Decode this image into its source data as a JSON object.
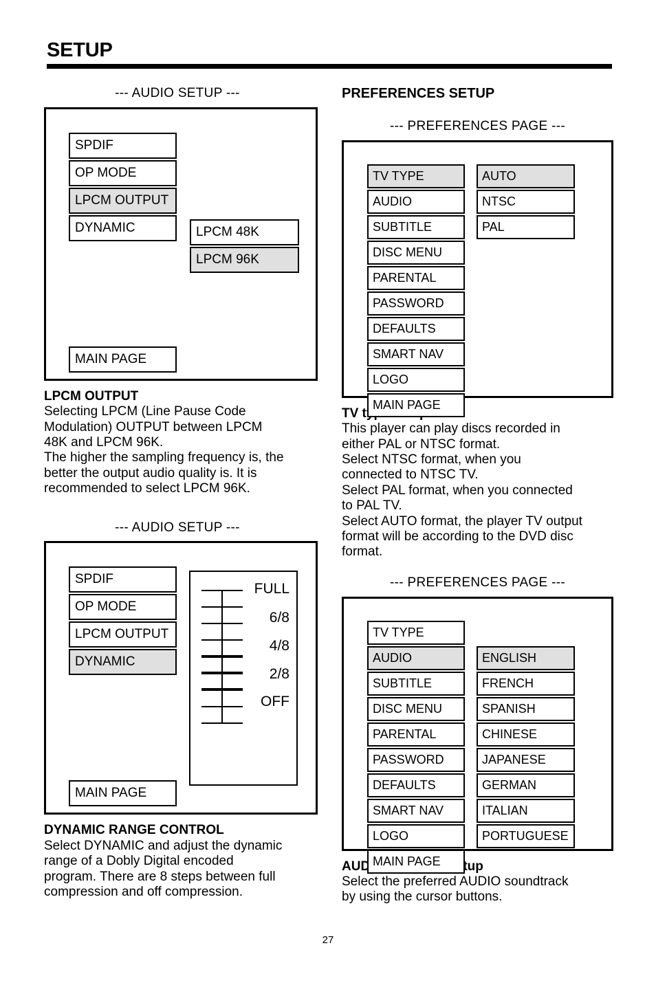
{
  "page": {
    "title": "SETUP",
    "number": "27"
  },
  "left_column": {
    "audio_screen_1": {
      "caption": "--- AUDIO SETUP ---",
      "left_menu": [
        {
          "label": "SPDIF",
          "selected": false
        },
        {
          "label": "OP MODE",
          "selected": false
        },
        {
          "label": "LPCM OUTPUT",
          "selected": true
        },
        {
          "label": "DYNAMIC",
          "selected": false
        }
      ],
      "right_menu": [
        {
          "label": "LPCM 48K",
          "selected": false
        },
        {
          "label": "LPCM 96K",
          "selected": true
        }
      ],
      "main_page": "MAIN PAGE"
    },
    "lpcm_block": {
      "heading": "LPCM OUTPUT",
      "text": "Selecting LPCM (Line Pause Code\nModulation) OUTPUT between LPCM\n48K and LPCM 96K.\nThe higher the sampling frequency is, the\nbetter the output audio quality is. It is\nrecommended to select LPCM 96K."
    },
    "audio_screen_2": {
      "caption": "--- AUDIO SETUP ---",
      "left_menu": [
        {
          "label": "SPDIF",
          "selected": false
        },
        {
          "label": "OP MODE",
          "selected": false
        },
        {
          "label": "LPCM OUTPUT",
          "selected": false
        },
        {
          "label": "DYNAMIC",
          "selected": true
        }
      ],
      "main_page": "MAIN PAGE",
      "slider": {
        "tick_count": 9,
        "thick_ticks": [
          5,
          6,
          7
        ],
        "labels": [
          "FULL",
          "6/8",
          "4/8",
          "2/8",
          "OFF"
        ]
      }
    },
    "dynamic_block": {
      "heading": "DYNAMIC RANGE CONTROL",
      "text": "Select DYNAMIC and adjust the dynamic\nrange of a Dobly Digital encoded\nprogram.  There are 8 steps between full\ncompression and off compression."
    }
  },
  "right_column": {
    "section_heading": "PREFERENCES SETUP",
    "pref_screen_1": {
      "caption": "--- PREFERENCES PAGE ---",
      "left_menu": [
        {
          "label": "TV TYPE",
          "selected": true
        },
        {
          "label": "AUDIO",
          "selected": false
        },
        {
          "label": "SUBTITLE",
          "selected": false
        },
        {
          "label": "DISC MENU",
          "selected": false
        },
        {
          "label": "PARENTAL",
          "selected": false
        },
        {
          "label": "PASSWORD",
          "selected": false
        },
        {
          "label": "DEFAULTS",
          "selected": false
        },
        {
          "label": "SMART NAV",
          "selected": false
        },
        {
          "label": "LOGO",
          "selected": false
        },
        {
          "label": "MAIN PAGE",
          "selected": false
        }
      ],
      "right_menu": [
        {
          "label": "AUTO",
          "selected": true
        },
        {
          "label": "NTSC",
          "selected": false
        },
        {
          "label": "PAL",
          "selected": false
        }
      ]
    },
    "tv_type_block": {
      "heading": "TV type setup",
      "text": "This player can play discs recorded in\neither PAL or NTSC format.\nSelect NTSC format, when you\nconnected to NTSC TV.\nSelect PAL format, when you connected\nto PAL TV.\nSelect AUTO format, the player TV output\nformat will be according to the DVD disc\nformat."
    },
    "pref_screen_2": {
      "caption": "--- PREFERENCES PAGE ---",
      "left_menu": [
        {
          "label": "TV TYPE",
          "selected": false
        },
        {
          "label": "AUDIO",
          "selected": true
        },
        {
          "label": "SUBTITLE",
          "selected": false
        },
        {
          "label": "DISC MENU",
          "selected": false
        },
        {
          "label": "PARENTAL",
          "selected": false
        },
        {
          "label": "PASSWORD",
          "selected": false
        },
        {
          "label": "DEFAULTS",
          "selected": false
        },
        {
          "label": "SMART NAV",
          "selected": false
        },
        {
          "label": "LOGO",
          "selected": false
        },
        {
          "label": "MAIN PAGE",
          "selected": false
        }
      ],
      "right_menu": [
        {
          "label": "ENGLISH",
          "selected": true
        },
        {
          "label": "FRENCH",
          "selected": false
        },
        {
          "label": "SPANISH",
          "selected": false
        },
        {
          "label": "CHINESE",
          "selected": false
        },
        {
          "label": "JAPANESE",
          "selected": false
        },
        {
          "label": "GERMAN",
          "selected": false
        },
        {
          "label": "ITALIAN",
          "selected": false
        },
        {
          "label": "PORTUGUESE",
          "selected": false
        }
      ]
    },
    "audio_lang_block": {
      "heading": "AUDIO language setup",
      "text": "Select the preferred AUDIO soundtrack\nby using the cursor buttons."
    }
  },
  "colors": {
    "highlight": "#e0e0e0",
    "ink": "#000000",
    "paper": "#ffffff"
  }
}
